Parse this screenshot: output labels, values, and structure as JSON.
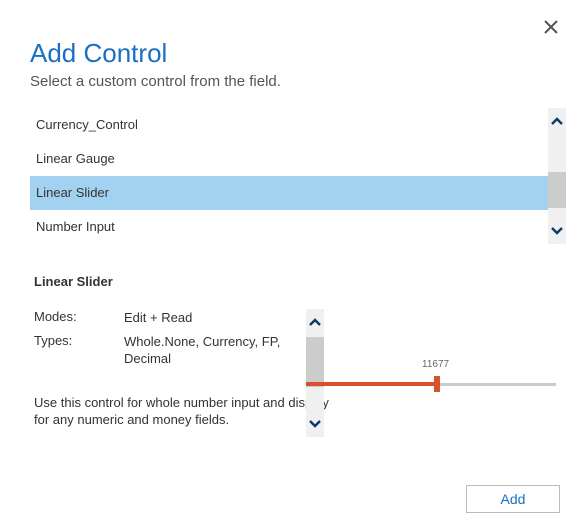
{
  "dialog": {
    "title": "Add Control",
    "subtitle": "Select a custom control from the field."
  },
  "control_list": {
    "items": [
      {
        "label": "Currency_Control",
        "selected": false
      },
      {
        "label": "Linear Gauge",
        "selected": false
      },
      {
        "label": "Linear Slider",
        "selected": true
      },
      {
        "label": "Number Input",
        "selected": false
      }
    ]
  },
  "details": {
    "heading": "Linear Slider",
    "modes_label": "Modes:",
    "modes_value": "Edit + Read",
    "types_label": "Types:",
    "types_value": "Whole.None, Currency, FP, Decimal",
    "description": "Use this control for whole number input and display for any numeric and money fields."
  },
  "preview": {
    "value": "11677"
  },
  "buttons": {
    "add": "Add"
  }
}
